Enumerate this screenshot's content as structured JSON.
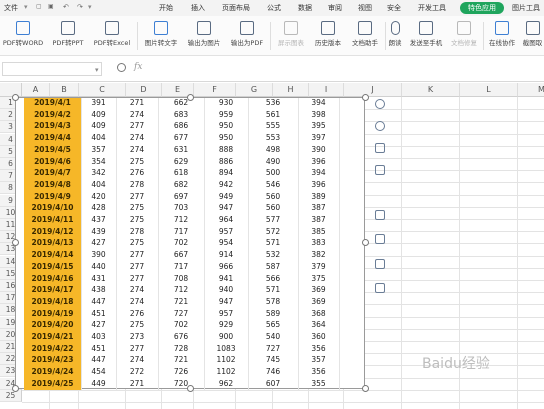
{
  "menubar": {
    "file": "文件",
    "items": [
      "开始",
      "插入",
      "页面布局",
      "公式",
      "数据",
      "审阅",
      "视图",
      "安全",
      "开发工具"
    ],
    "special": "特色应用",
    "image_tools": "图片工具"
  },
  "ribbon": {
    "buttons": [
      {
        "label": "PDF转WORD",
        "icon": "pdf-to-word-icon",
        "enabled": true
      },
      {
        "label": "PDF转PPT",
        "icon": "pdf-to-ppt-icon",
        "enabled": true
      },
      {
        "label": "PDF转Excel",
        "icon": "pdf-to-excel-icon",
        "enabled": true
      },
      {
        "label": "图片转文字",
        "icon": "image-to-text-icon",
        "enabled": true
      },
      {
        "label": "输出为图片",
        "icon": "export-image-icon",
        "enabled": true
      },
      {
        "label": "输出为PDF",
        "icon": "export-pdf-icon",
        "enabled": true
      },
      {
        "label": "屏示图表",
        "icon": "chart-icon",
        "enabled": false
      },
      {
        "label": "历史版本",
        "icon": "history-icon",
        "enabled": true
      },
      {
        "label": "文档助手",
        "icon": "assistant-icon",
        "enabled": true
      },
      {
        "label": "朗读",
        "icon": "microphone-icon",
        "enabled": true
      },
      {
        "label": "发送至手机",
        "icon": "phone-icon",
        "enabled": true
      },
      {
        "label": "文档修复",
        "icon": "repair-icon",
        "enabled": false
      },
      {
        "label": "在线协作",
        "icon": "collab-icon",
        "enabled": true
      },
      {
        "label": "截图取",
        "icon": "screenshot-icon",
        "enabled": true
      }
    ]
  },
  "formula_bar": {
    "fx": "fx",
    "zoom_icon": "zoom-icon"
  },
  "columns": [
    "A",
    "B",
    "C",
    "D",
    "E",
    "F",
    "G",
    "H",
    "I",
    "J",
    "K",
    "L",
    "M"
  ],
  "rows": [
    "1",
    "2",
    "3",
    "4",
    "5",
    "6",
    "7",
    "8",
    "9",
    "10",
    "11",
    "12",
    "13",
    "14",
    "15",
    "16",
    "17",
    "18",
    "19",
    "20",
    "21",
    "22",
    "23",
    "24",
    "25"
  ],
  "table": {
    "dates": [
      "2019/4/1",
      "2019/4/2",
      "2019/4/3",
      "2019/4/4",
      "2019/4/5",
      "2019/4/6",
      "2019/4/7",
      "2019/4/8",
      "2019/4/9",
      "2019/4/10",
      "2019/4/11",
      "2019/4/12",
      "2019/4/13",
      "2019/4/14",
      "2019/4/15",
      "2019/4/16",
      "2019/4/17",
      "2019/4/18",
      "2019/4/19",
      "2019/4/20",
      "2019/4/21",
      "2019/4/22",
      "2019/4/23",
      "2019/4/24",
      "2019/4/25"
    ],
    "values": [
      [
        "391",
        "271",
        "662",
        "930",
        "536",
        "394"
      ],
      [
        "409",
        "274",
        "683",
        "959",
        "561",
        "398"
      ],
      [
        "409",
        "277",
        "686",
        "950",
        "555",
        "395"
      ],
      [
        "404",
        "274",
        "677",
        "950",
        "553",
        "397"
      ],
      [
        "357",
        "274",
        "631",
        "888",
        "498",
        "390"
      ],
      [
        "354",
        "275",
        "629",
        "886",
        "490",
        "396"
      ],
      [
        "342",
        "276",
        "618",
        "894",
        "500",
        "394"
      ],
      [
        "404",
        "278",
        "682",
        "942",
        "546",
        "396"
      ],
      [
        "420",
        "277",
        "697",
        "949",
        "560",
        "389"
      ],
      [
        "428",
        "275",
        "703",
        "947",
        "560",
        "387"
      ],
      [
        "437",
        "275",
        "712",
        "964",
        "577",
        "387"
      ],
      [
        "439",
        "278",
        "717",
        "957",
        "572",
        "385"
      ],
      [
        "427",
        "275",
        "702",
        "954",
        "571",
        "383"
      ],
      [
        "390",
        "277",
        "667",
        "914",
        "532",
        "382"
      ],
      [
        "440",
        "277",
        "717",
        "966",
        "587",
        "379"
      ],
      [
        "431",
        "277",
        "708",
        "941",
        "566",
        "375"
      ],
      [
        "438",
        "274",
        "712",
        "940",
        "571",
        "369"
      ],
      [
        "447",
        "274",
        "721",
        "947",
        "578",
        "369"
      ],
      [
        "451",
        "276",
        "727",
        "957",
        "589",
        "368"
      ],
      [
        "427",
        "275",
        "702",
        "929",
        "565",
        "364"
      ],
      [
        "403",
        "273",
        "676",
        "900",
        "540",
        "360"
      ],
      [
        "451",
        "277",
        "728",
        "1083",
        "727",
        "356"
      ],
      [
        "447",
        "274",
        "721",
        "1102",
        "745",
        "357"
      ],
      [
        "454",
        "272",
        "726",
        "1102",
        "746",
        "356"
      ],
      [
        "449",
        "271",
        "720",
        "962",
        "607",
        "355"
      ]
    ]
  },
  "float_tools": [
    "minus-circle-icon",
    "zoom-in-icon",
    "crop-icon",
    "crop-frame-icon",
    "image-stack-icon",
    "image-text-icon",
    "image-copy-icon",
    "image-compress-icon"
  ],
  "watermark": "Baidu经验"
}
